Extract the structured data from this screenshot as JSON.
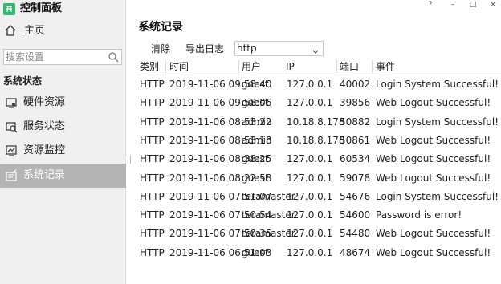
{
  "app": {
    "title": "控制面板"
  },
  "window_controls": {
    "help": "?",
    "minimize": "–",
    "maximize": "□",
    "close": "×"
  },
  "sidebar": {
    "home_label": "主页",
    "search": {
      "placeholder": "搜索设置",
      "value": ""
    },
    "section": "系统状态",
    "items": [
      {
        "label": "硬件资源",
        "icon": "hardware-icon",
        "active": false
      },
      {
        "label": "服务状态",
        "icon": "service-status-icon",
        "active": false
      },
      {
        "label": "资源监控",
        "icon": "monitor-icon",
        "active": false
      },
      {
        "label": "系统记录",
        "icon": "log-icon",
        "active": true
      }
    ]
  },
  "main": {
    "title": "系统记录",
    "toolbar": {
      "clear_label": "清除",
      "export_label": "导出日志",
      "filter_value": "http"
    },
    "table": {
      "headers": [
        "类别",
        "时间",
        "用户",
        "IP",
        "端口",
        "事件"
      ],
      "rows": [
        [
          "HTTP",
          "2019-11-06 09:58:40",
          "guest",
          "127.0.0.1",
          "40002",
          "Login System Successful!"
        ],
        [
          "HTTP",
          "2019-11-06 09:58:06",
          "guest",
          "127.0.0.1",
          "39856",
          "Web Logout Successful!"
        ],
        [
          "HTTP",
          "2019-11-06 08:53:22",
          "admin",
          "10.18.8.178",
          "50882",
          "Login System Successful!"
        ],
        [
          "HTTP",
          "2019-11-06 08:53:18",
          "admin",
          "10.18.8.178",
          "50861",
          "Web Logout Successful!"
        ],
        [
          "HTTP",
          "2019-11-06 08:38:25",
          "guest",
          "127.0.0.1",
          "60534",
          "Web Logout Successful!"
        ],
        [
          "HTTP",
          "2019-11-06 08:22:58",
          "guest",
          "127.0.0.1",
          "59078",
          "Web Logout Successful!"
        ],
        [
          "HTTP",
          "2019-11-06 07:51:07",
          "teramaster",
          "127.0.0.1",
          "54676",
          "Login System Successful!"
        ],
        [
          "HTTP",
          "2019-11-06 07:50:54",
          "teramaster",
          "127.0.0.1",
          "54600",
          "Password is error!"
        ],
        [
          "HTTP",
          "2019-11-06 07:50:35",
          "teramaster",
          "127.0.0.1",
          "54480",
          "Web Logout Successful!"
        ],
        [
          "HTTP",
          "2019-11-06 06:51:03",
          "guest",
          "127.0.0.1",
          "48674",
          "Web Logout Successful!"
        ]
      ]
    }
  },
  "colors": {
    "logo": "#3cb371",
    "sidebar_bg": "#f0f0f0",
    "active_item_bg": "#b4b4b4"
  }
}
